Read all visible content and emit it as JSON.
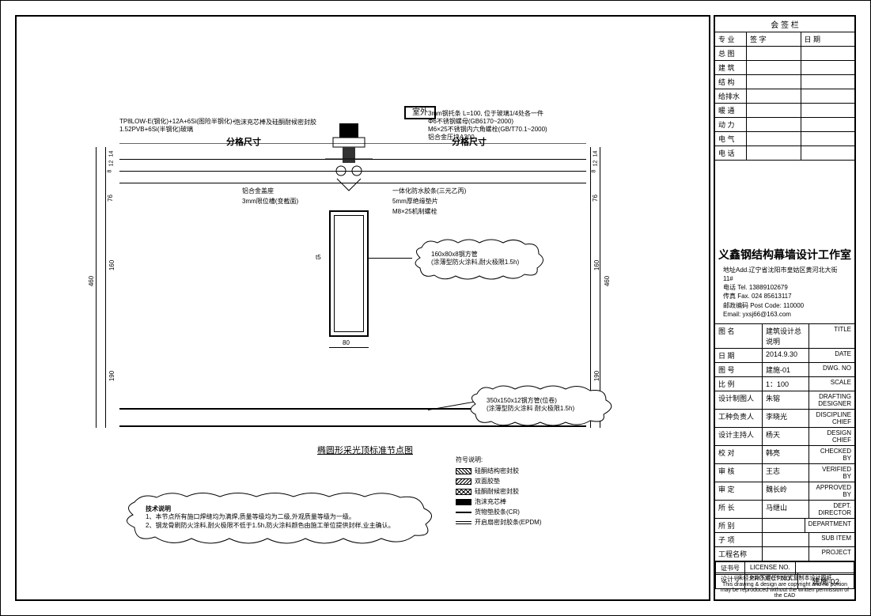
{
  "approval_header": "会 签 栏",
  "approval_cols": [
    "专 业",
    "签 字",
    "日 期"
  ],
  "approval_rows": [
    "总 图",
    "建 筑",
    "结 构",
    "给排水",
    "暖 通",
    "动 力",
    "电 气",
    "电 话"
  ],
  "company": {
    "name": "义鑫钢结构幕墙设计工作室",
    "addr": "地址Add.辽宁省沈阳市皇姑区黄河北大街11#",
    "tel": "电话 Tel. 13889102679",
    "fax": "传真 Fax. 024 85613117",
    "post": "邮政编码 Post Code: 110000",
    "email": "Email: yxsj66@163.com"
  },
  "info_rows": [
    {
      "l": "图 名",
      "m": "建筑设计总说明",
      "r": "TITLE"
    },
    {
      "l": "日 期",
      "m": "2014.9.30",
      "r": "DATE"
    },
    {
      "l": "图 号",
      "m": "建施-01",
      "r": "DWG. NO"
    },
    {
      "l": "比 例",
      "m": "1：100",
      "r": "SCALE"
    },
    {
      "l": "设计制图人",
      "m": "朱镕",
      "r": "DRAFTING DESIGNER"
    },
    {
      "l": "工种负责人",
      "m": "李晓光",
      "r": "DISCIPLINE CHIEF"
    },
    {
      "l": "设计主持人",
      "m": "杨天",
      "r": "DESIGN CHIEF"
    },
    {
      "l": "校 对",
      "m": "韩亮",
      "r": "CHECKED BY"
    },
    {
      "l": "审 核",
      "m": "王志",
      "r": "VERIFIED BY"
    },
    {
      "l": "审 定",
      "m": "魏长岭",
      "r": "APPROVED BY"
    },
    {
      "l": "所 长",
      "m": "马继山",
      "r": "DEPT. DIRECTOR"
    },
    {
      "l": "所 别",
      "m": "",
      "r": "DEPARTMENT"
    },
    {
      "l": "子 项",
      "m": "",
      "r": "SUB ITEM"
    },
    {
      "l": "工程名称",
      "m": "",
      "r": "PROJECT"
    }
  ],
  "corner": {
    "license_l": "证书号",
    "license_r": "LICENSE NO.",
    "proj_l": "设计号",
    "proj_r": "PROJECT NO.",
    "sheet": "建施-02"
  },
  "footer": {
    "zh": "未经允许不得任何方式复制本设计图纸",
    "en": "This drawing & design are copyright and no portion may be reproduced without the written permission of the CAD"
  },
  "drawing": {
    "room_label": "室外",
    "dim_label_left": "分格尺寸",
    "dim_label_right": "分格尺寸",
    "title": "椭圆形采光顶标准节点图",
    "left_callouts": [
      "TP8LOW-E(钢化)+12A+6Si(图险半钢化)+",
      "1.52PVB+6Si(半钢化)玻璃",
      "泡沫充芯棒及硅酮耐候密封胶"
    ],
    "right_callouts": [
      "3mm钢托条 L=100, 位于玻璃1/4处各一件",
      "Φ6不锈钢螺母(GB6170~2000)",
      "M6×25不锈钢内六角螺栓(GB/T70.1~2000)",
      "铝合金压块A300"
    ],
    "mid_left_callouts": [
      "铝合金盖座",
      "3mm限位槽(变截面)"
    ],
    "mid_right_callouts": [
      "一体化防水胶条(三元乙丙)",
      "5mm厚绝缘垫片",
      "M8×25机制螺栓"
    ],
    "tube1_note": [
      "160x80x8钢方管",
      "(涂薄型防火涂料,耐火极限1.5h)"
    ],
    "tube2_note": [
      "350x150x12钢方管(位卷)",
      "(涂薄型防火涂料 耐火极限1.5h)"
    ],
    "tech_title": "技术说明",
    "tech_notes": [
      "1、本节点所有施口焊缝均为满焊,质量等级均为二级,外观质量等级为一级。",
      "2、钢龙骨刷防火涂料,耐火极限不低于1.5h,防火涂料颜色由施工单位提供封样,业主确认。"
    ],
    "dims": {
      "v_total": "460",
      "v_190_top": "190",
      "v_160": "160",
      "v_76": "76",
      "v_190_bot": "190",
      "v_14": "14",
      "v_12": "12",
      "v_8": "8",
      "h_80": "80",
      "angle_t5": "t5"
    },
    "legend_title": "符号说明:",
    "legend": [
      {
        "sw": "sw-hatch1",
        "t": "硅酮结构密封胶"
      },
      {
        "sw": "sw-hatch2",
        "t": "双面胶垫"
      },
      {
        "sw": "sw-cross",
        "t": "硅酮耐候密封胶"
      },
      {
        "sw": "sw-solid",
        "t": "泡沫充芯棒"
      },
      {
        "sw": "sw-line",
        "t": "货物垫胶条(CR)"
      },
      {
        "sw": "sw-dline",
        "t": "开启扇密封胶条(EPDM)"
      }
    ]
  }
}
